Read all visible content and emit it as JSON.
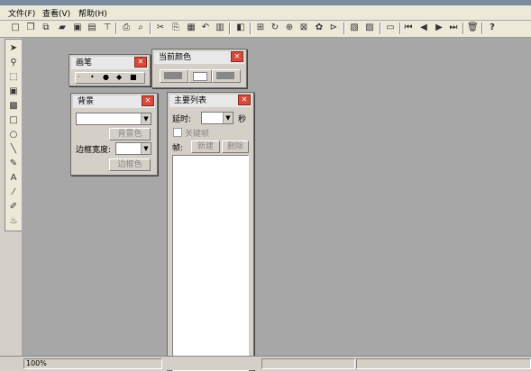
{
  "menu": {
    "file": "文件(F)",
    "view": "查看(V)",
    "help": "帮助(H)"
  },
  "toolbar": {
    "icons": [
      "new-file-icon",
      "new-page-icon",
      "copy-page-icon",
      "open-folder-icon",
      "save-icon",
      "save-as-icon",
      "export-icon",
      "print-icon",
      "print-preview-icon",
      "cut-icon",
      "copy-icon",
      "paste-icon",
      "undo-icon",
      "redo-icon",
      "layers-icon",
      "grid-icon",
      "rotate-icon",
      "align-icon",
      "transform-icon",
      "animate-icon",
      "properties-icon",
      "first-frame-icon",
      "prev-frame-icon",
      "next-frame-icon",
      "last-frame-icon",
      "delete-icon",
      "help-icon"
    ]
  },
  "left_tools": [
    "select-arrow-icon",
    "zoom-icon",
    "rectangle-select-icon",
    "fill-rect-icon",
    "hatch-icon",
    "rectangle-icon",
    "ellipse-icon",
    "line-icon",
    "pencil-icon",
    "text-icon",
    "eyedropper-icon",
    "brush-icon",
    "fill-bucket-icon"
  ],
  "brush_panel": {
    "title": "画笔",
    "sizes": [
      "·",
      "•",
      "●",
      "◆",
      "■"
    ]
  },
  "color_panel": {
    "title": "当前颜色"
  },
  "bg_panel": {
    "title": "背景",
    "bg_color_button": "背景色",
    "border_width_label": "边框宽度:",
    "border_color_button": "边框色"
  },
  "main_list": {
    "title": "主要列表",
    "delay_label": "延时:",
    "delay_unit": "秒",
    "keyframe_label": "关键帧",
    "frame_label": "帧:",
    "new_button": "新建",
    "delete_button": "删除"
  },
  "status": {
    "zoom": "100%"
  },
  "colors": {
    "workspace": "#a7a7a7",
    "close": "#d84a3c"
  }
}
